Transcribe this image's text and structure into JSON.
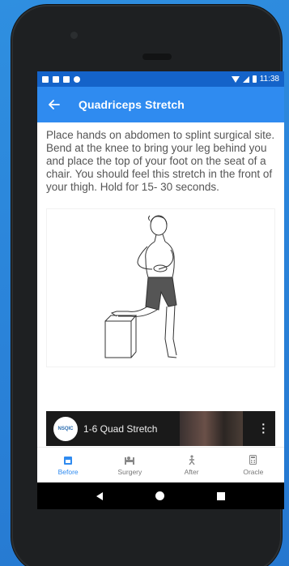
{
  "status_bar": {
    "time": "11:38"
  },
  "app_bar": {
    "title": "Quadriceps Stretch",
    "back_icon": "arrow-left-icon"
  },
  "exercise": {
    "description": "Place hands on abdomen to splint surgical site. Bend at the knee to bring your leg behind you and place the top of your foot on the seat of a chair. You should feel this stretch in the front of your thigh. Hold for 15- 30 seconds."
  },
  "video": {
    "title": "1-6 Quad Stretch",
    "channel_logo": "NSQIC"
  },
  "bottom_nav": {
    "items": [
      {
        "label": "Before",
        "icon": "calendar-icon",
        "active": true
      },
      {
        "label": "Surgery",
        "icon": "hospital-bed-icon",
        "active": false
      },
      {
        "label": "After",
        "icon": "walking-person-icon",
        "active": false
      },
      {
        "label": "Oracle",
        "icon": "calculator-icon",
        "active": false
      }
    ]
  },
  "colors": {
    "status_bar": "#1463c9",
    "app_bar": "#2f8bf0",
    "active_nav": "#2f8bf0",
    "background": "#2a83d9"
  }
}
